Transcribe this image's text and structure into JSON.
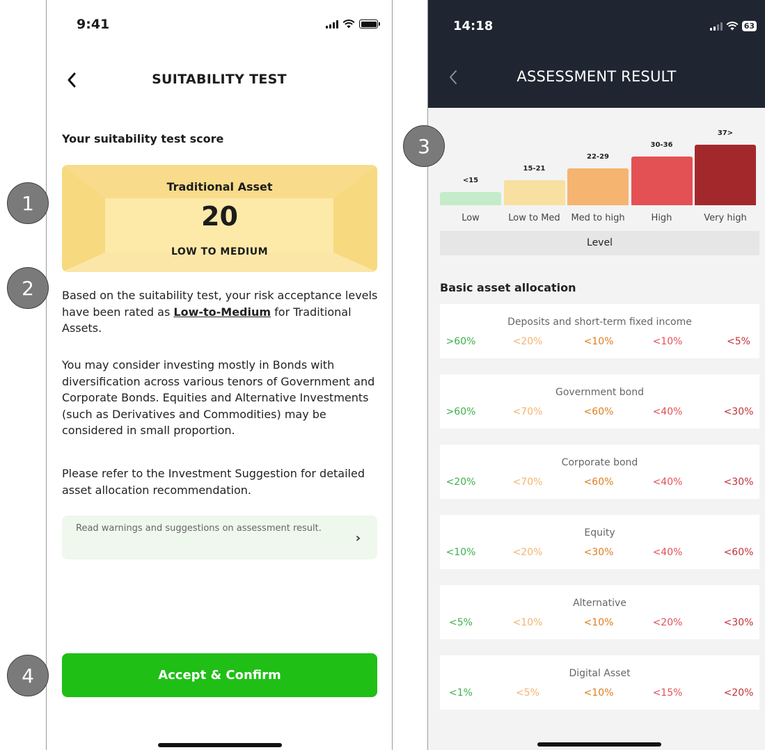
{
  "left": {
    "status_time": "9:41",
    "title": "SUITABILITY TEST",
    "score_heading": "Your suitability test score",
    "score_card": {
      "asset": "Traditional Asset",
      "score": "20",
      "level": "LOW TO MEDIUM"
    },
    "para1_before": "Based on the suitability test, your risk acceptance levels have been rated as ",
    "para1_link": "Low-to-Medium",
    "para1_after": " for Traditional Assets.",
    "para2": "You may consider investing mostly in Bonds with diversification across various tenors of Government and Corporate Bonds. Equities and Alternative Investments (such as Derivatives and Commodities) may be considered in small proportion.",
    "para3": "Please refer to the Investment Suggestion for detailed asset allocation recommendation.",
    "warning_text": "Read warnings and suggestions on assessment result.",
    "confirm_label": "Accept & Confirm"
  },
  "right": {
    "status_time": "14:18",
    "battery": "63",
    "title": "ASSESSMENT RESULT",
    "level_label": "Level",
    "levels": [
      {
        "range": "<15",
        "label": "Low",
        "color": "#c4ecca",
        "rank": 1
      },
      {
        "range": "15-21",
        "label": "Low to Med",
        "color": "#f8e0a0",
        "rank": 2
      },
      {
        "range": "22-29",
        "label": "Med to high",
        "color": "#f6b471",
        "rank": 3
      },
      {
        "range": "30-36",
        "label": "High",
        "color": "#e45154",
        "rank": 4
      },
      {
        "range": "37>",
        "label": "Very high",
        "color": "#a3282b",
        "rank": 5
      }
    ],
    "alloc_heading": "Basic asset allocation",
    "value_colors": [
      "#3cb04a",
      "#f2b46e",
      "#e07d1e",
      "#e34f55",
      "#c13136"
    ],
    "allocations": [
      {
        "name": "Deposits and short-term fixed income",
        "values": [
          ">60%",
          "<20%",
          "<10%",
          "<10%",
          "<5%"
        ]
      },
      {
        "name": "Government bond",
        "values": [
          ">60%",
          "<70%",
          "<60%",
          "<40%",
          "<30%"
        ]
      },
      {
        "name": "Corporate bond",
        "values": [
          "<20%",
          "<70%",
          "<60%",
          "<40%",
          "<30%"
        ]
      },
      {
        "name": "Equity",
        "values": [
          "<10%",
          "<20%",
          "<30%",
          "<40%",
          "<60%"
        ]
      },
      {
        "name": "Alternative",
        "values": [
          "<5%",
          "<10%",
          "<10%",
          "<20%",
          "<30%"
        ]
      },
      {
        "name": "Digital Asset",
        "values": [
          "<1%",
          "<5%",
          "<10%",
          "<15%",
          "<20%"
        ]
      }
    ]
  },
  "callouts": [
    "1",
    "2",
    "3",
    "4"
  ]
}
